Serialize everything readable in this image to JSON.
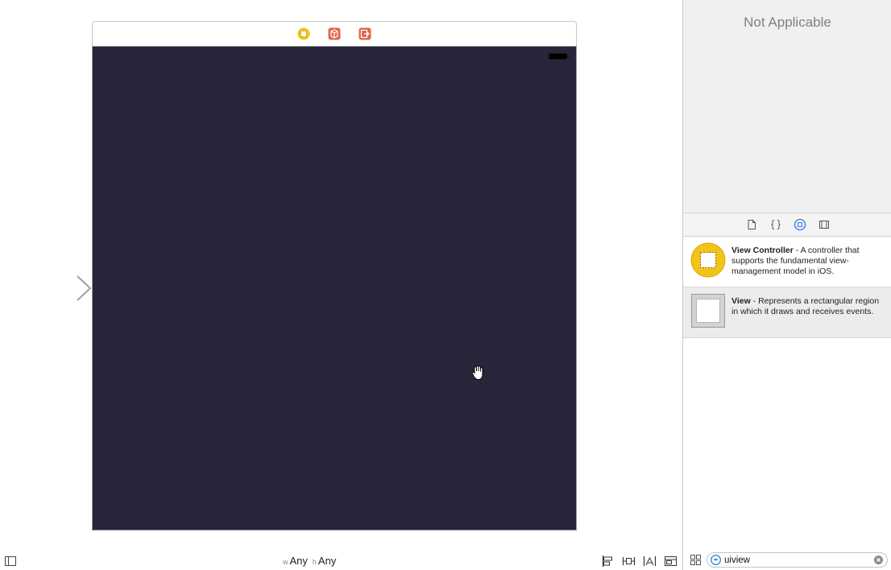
{
  "canvas": {
    "scene_background": "#29243a",
    "dock_icons": [
      "view-controller-icon",
      "first-responder-icon",
      "exit-icon"
    ],
    "cursor_icon": "open-hand-icon",
    "entry_arrow_icon": "initial-view-controller-arrow-icon"
  },
  "bottom_bar": {
    "doc_outline_icon": "document-outline-toggle-icon",
    "size_class": {
      "width_prefix": "w",
      "width_value": "Any",
      "height_prefix": "h",
      "height_value": "Any"
    },
    "layout_tools": [
      "align-icon",
      "pin-icon",
      "resolve-auto-layout-icon",
      "resizing-behavior-icon"
    ]
  },
  "inspector": {
    "empty_message": "Not Applicable"
  },
  "library": {
    "tabs": [
      "file-template-icon",
      "code-snippet-icon",
      "object-library-icon",
      "media-library-icon"
    ],
    "active_tab": "object-library-icon",
    "accent_color": "#3a8ee6",
    "items": [
      {
        "title": "View Controller",
        "description": " - A controller that supports the fundamental view-management model in iOS.",
        "icon": "view-controller-icon"
      },
      {
        "title": "View",
        "description": " - Represents a rectangular region in which it draws and receives events.",
        "icon": "view-icon"
      }
    ]
  },
  "filter": {
    "grid_icon": "grid-view-toggle-icon",
    "filter_icon": "filter-icon",
    "value": "uiview",
    "clear_icon": "clear-search-icon"
  }
}
